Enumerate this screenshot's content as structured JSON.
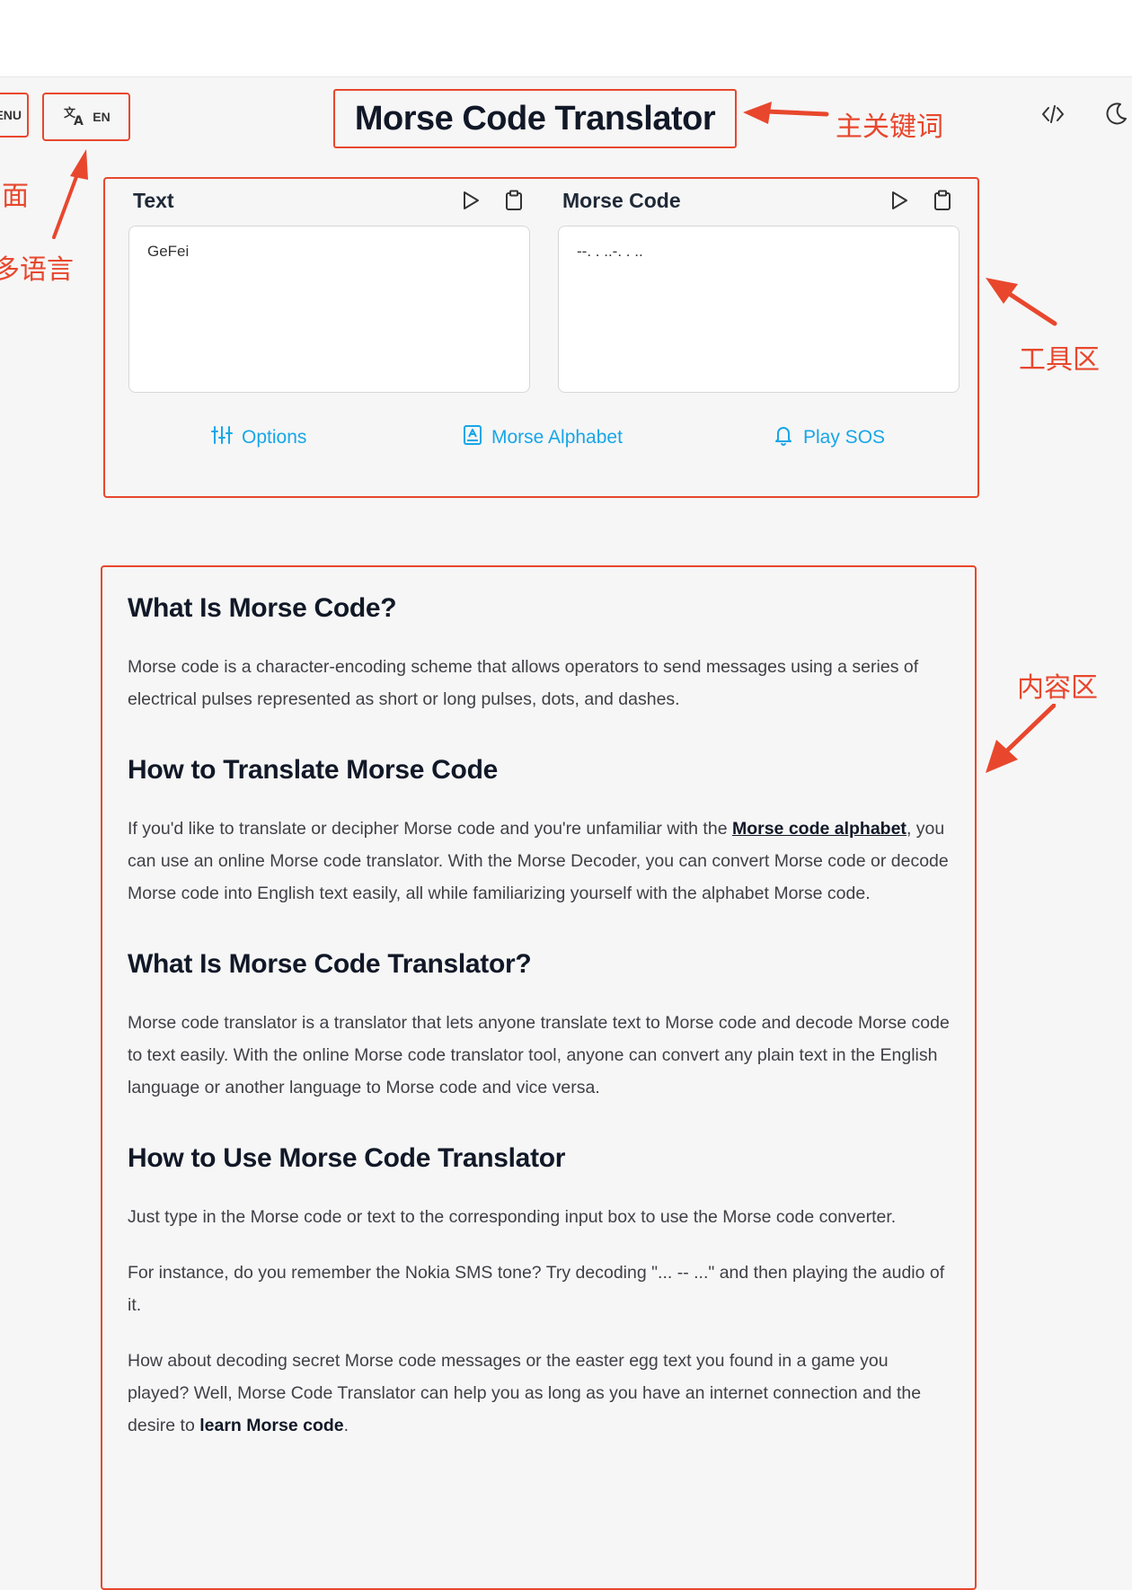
{
  "header": {
    "menu_label": "ENU",
    "language_code": "EN",
    "title": "Morse Code Translator"
  },
  "annotations": {
    "keyword": "主关键词",
    "page_fragment": "面",
    "multilang_fragment": "多语言",
    "tool_area": "工具区",
    "content_area": "内容区"
  },
  "tool": {
    "text_label": "Text",
    "text_value": "GeFei",
    "morse_label": "Morse Code",
    "morse_value": "--. . ..-. . ..",
    "options_label": "Options",
    "alphabet_label": "Morse Alphabet",
    "sos_label": "Play SOS"
  },
  "content": {
    "s1_heading": "What Is Morse Code?",
    "s1_p1": "Morse code is a character-encoding scheme that allows operators to send messages using a series of electrical pulses represented as short or long pulses, dots, and dashes.",
    "s2_heading": "How to Translate Morse Code",
    "s2_p1_a": "If you'd like to translate or decipher Morse code and you're unfamiliar with the ",
    "s2_p1_link": "Morse code alphabet",
    "s2_p1_b": ", you can use an online Morse code translator. With the Morse Decoder, you can convert Morse code or decode Morse code into English text easily, all while familiarizing yourself with the alphabet Morse code.",
    "s3_heading": "What Is Morse Code Translator?",
    "s3_p1": "Morse code translator is a translator that lets anyone translate text to Morse code and decode Morse code to text easily. With the online Morse code translator tool, anyone can convert any plain text in the English language or another language to Morse code and vice versa.",
    "s4_heading": "How to Use Morse Code Translator",
    "s4_p1": "Just type in the Morse code or text to the corresponding input box to use the Morse code converter.",
    "s4_p2": "For instance, do you remember the Nokia SMS tone? Try decoding \"... -- ...\" and then playing the audio of it.",
    "s4_p3_a": "How about decoding secret Morse code messages or the easter egg text you found in a game you played? Well, Morse Code Translator can help you as long as you have an internet connection and the desire to ",
    "s4_p3_link": "learn Morse code",
    "s4_p3_b": "."
  }
}
